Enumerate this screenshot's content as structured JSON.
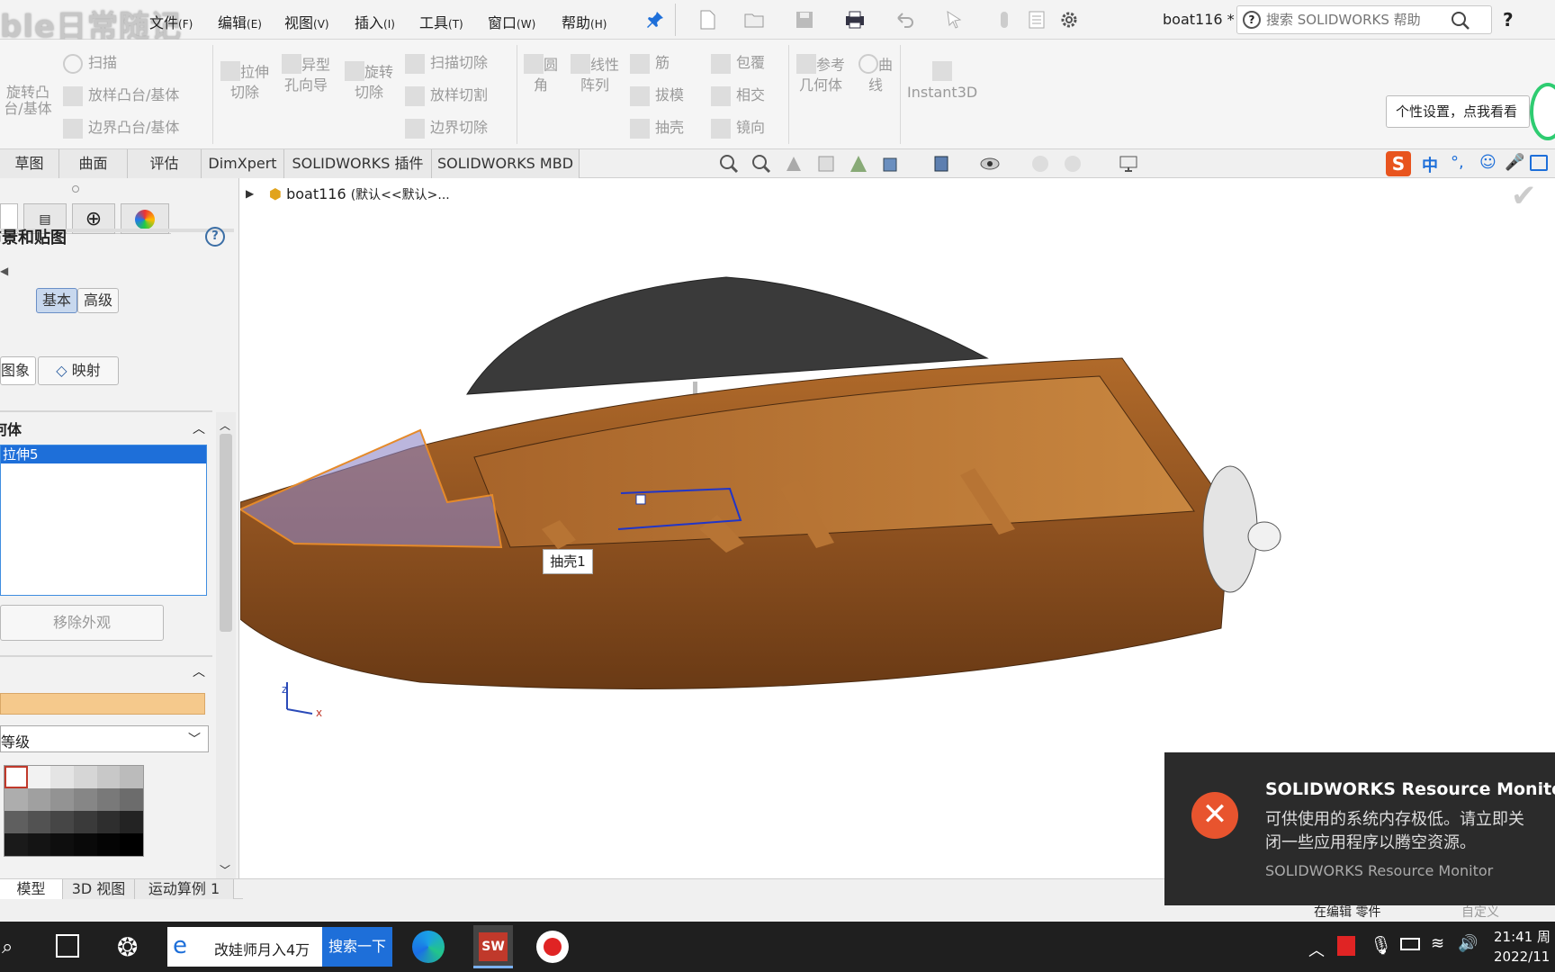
{
  "watermark": "ble日常随记",
  "menu": {
    "file": "文件",
    "file_key": "(F)",
    "edit": "编辑",
    "edit_key": "(E)",
    "view": "视图",
    "view_key": "(V)",
    "insert": "插入",
    "insert_key": "(I)",
    "tools": "工具",
    "tools_key": "(T)",
    "window": "窗口",
    "window_key": "(W)",
    "help": "帮助",
    "help_key": "(H)"
  },
  "doc_title": "boat116 *",
  "search": {
    "placeholder": "搜索 SOLIDWORKS 帮助"
  },
  "ribbon": {
    "revolve_boss": "旋转凸台/基体",
    "sweep": "扫描",
    "loft_boss": "放样凸台/基体",
    "boundary_boss": "边界凸台/基体",
    "extrude_cut": "拉伸切除",
    "hole_wizard": "异型孔向导",
    "revolve_cut": "旋转切除",
    "sweep_cut": "扫描切除",
    "loft_cut": "放样切割",
    "boundary_cut": "边界切除",
    "fillet": "圆角",
    "linear_pattern": "线性阵列",
    "rib": "筋",
    "draft": "拔模",
    "shell": "抽壳",
    "wrap": "包覆",
    "intersect": "相交",
    "mirror": "镜向",
    "ref_geometry": "参考几何体",
    "curves": "曲线",
    "instant3d": "Instant3D"
  },
  "tooltip_personal": "个性设置，点我看看",
  "cmd_tabs": [
    "草图",
    "曲面",
    "评估",
    "DimXpert",
    "SOLIDWORKS 插件",
    "SOLIDWORKS MBD"
  ],
  "feature_tree": {
    "doc": "boat116",
    "config": "(默认<<默认>..."
  },
  "panel": {
    "title": "外观、布景和贴图",
    "basic": "基本",
    "advanced": "高级",
    "appearance": "图象",
    "mapping": "映射",
    "selection_header": "所选几何体",
    "selected_item": "拉伸5",
    "remove_btn": "移除外观",
    "level_label": "等级"
  },
  "viewport": {
    "shell_tag": "抽壳1"
  },
  "bottom_tabs": [
    "模型",
    "3D 视图",
    "运动算例 1"
  ],
  "status": {
    "editing": "在编辑 零件",
    "custom": "自定义"
  },
  "toast": {
    "title": "SOLIDWORKS Resource Monitor",
    "line1": "可供使用的系统内存极低。请立即关",
    "line2": "闭一些应用程序以腾空资源。",
    "source": "SOLIDWORKS Resource Monitor"
  },
  "taskbar": {
    "ie_label": "改娃师月入4万",
    "ie_button": "搜索一下",
    "time": "21:41 周",
    "date": "2022/11"
  },
  "ime": {
    "lang": "中"
  },
  "colors": {
    "accent": "#1e6fd9",
    "toast_bg": "#2b2b2b",
    "wood": "#9a5a22",
    "selection": "#3f8de0"
  }
}
